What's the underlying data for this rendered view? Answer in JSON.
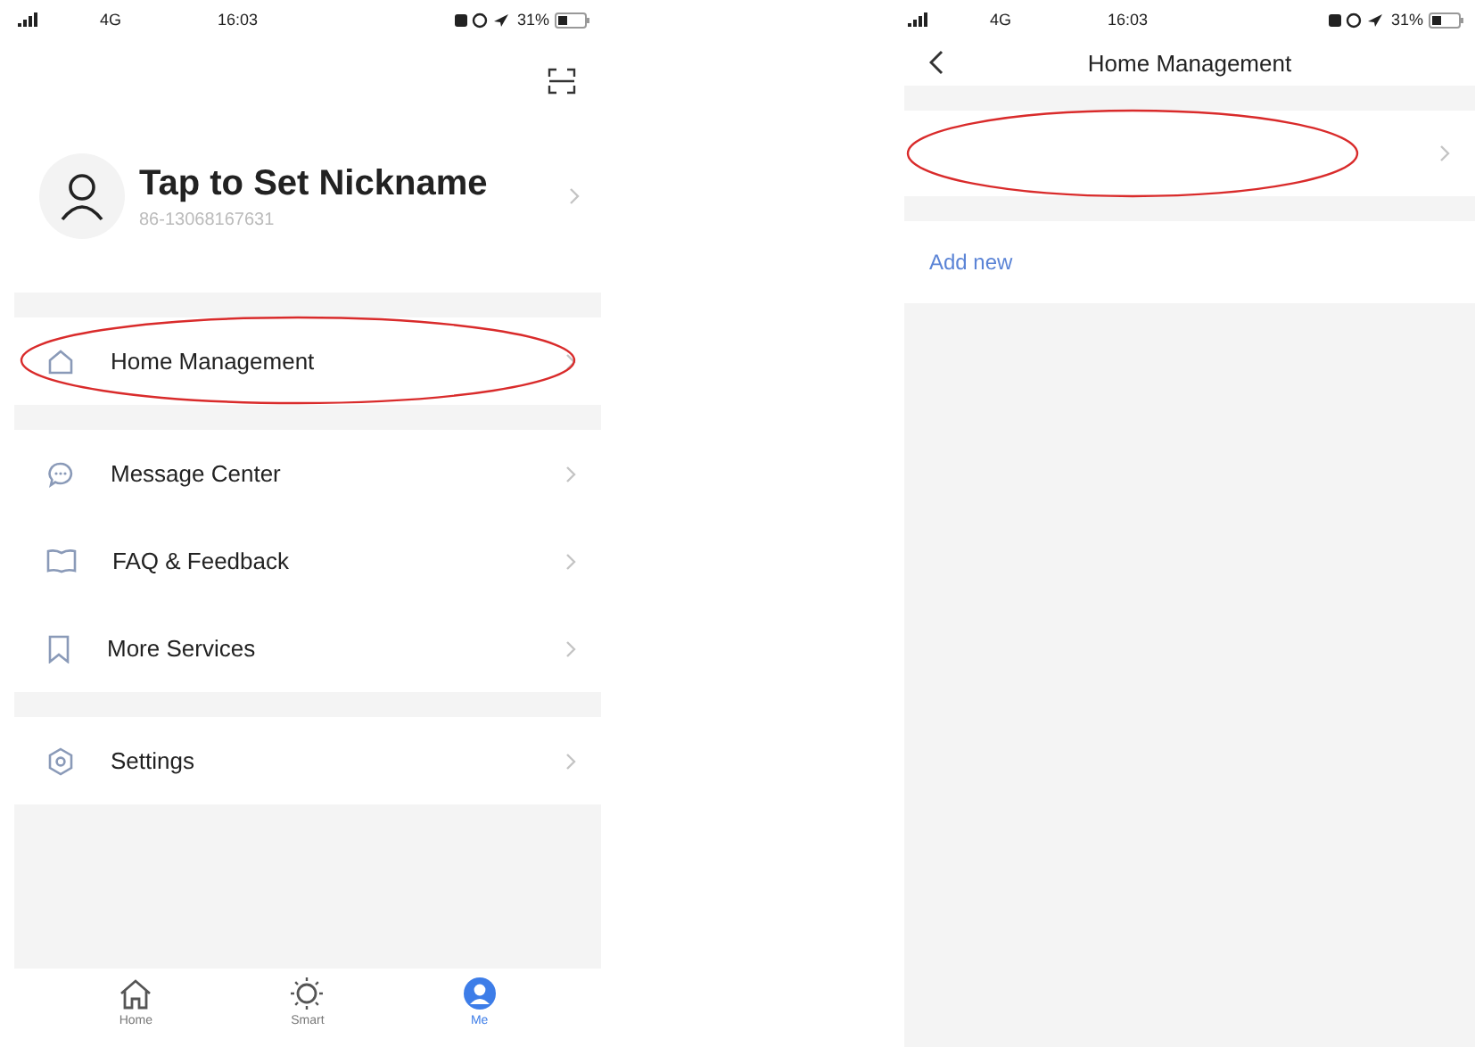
{
  "screens": [
    {
      "kind": "profile",
      "status_bar": {
        "network": "4G",
        "time": "16:03",
        "battery": "31%"
      },
      "profile": {
        "nickname": "Tap to Set Nickname",
        "phone": "86-13068167631"
      },
      "menu_groups": [
        [
          {
            "label": "Home Management",
            "highlighted": true
          }
        ],
        [
          {
            "label": "Message Center",
            "highlighted": false
          },
          {
            "label": "FAQ & Feedback",
            "highlighted": false
          },
          {
            "label": "More Services",
            "highlighted": false
          }
        ],
        [
          {
            "label": "Settings",
            "highlighted": false
          }
        ]
      ],
      "tabs": [
        {
          "label": "Home",
          "selected": false
        },
        {
          "label": "Smart",
          "selected": false
        },
        {
          "label": "Me",
          "selected": true
        }
      ]
    },
    {
      "kind": "home_management",
      "status_bar": {
        "network": "4G",
        "time": "16:03",
        "battery": "31%"
      },
      "title": "Home Management",
      "home_row": {
        "highlighted": true
      },
      "add_link": "Add new"
    }
  ]
}
